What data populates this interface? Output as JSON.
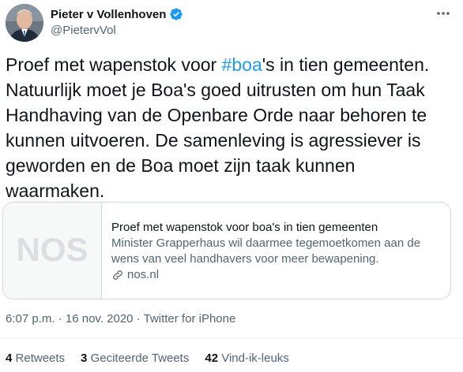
{
  "author": {
    "display_name": "Pieter v Vollenhoven",
    "handle": "@PietervVol",
    "verified_icon": "verified-badge-icon",
    "more_icon": "more-options-icon"
  },
  "tweet": {
    "text_before_hashtag": "Proef met wapenstok voor ",
    "hashtag": "#boa",
    "text_after_hashtag": "'s in tien gemeenten.\nNatuurlijk moet je Boa's goed uitrusten om hun Taak Handhaving van de Openbare Orde naar behoren te kunnen uitvoeren. De samenleving is agressiever is geworden en de Boa moet zijn taak kunnen waarmaken."
  },
  "card": {
    "logo_text": "NOS",
    "title": "Proef met wapenstok voor boa's in tien gemeenten",
    "description_line1": "Minister Grapperhaus wil daarmee tegemoetkomen aan de",
    "description_line2": "wens van veel handhavers voor meer bewapening.",
    "domain": "nos.nl",
    "link_icon": "link-icon"
  },
  "meta": {
    "time": "6:07 p.m.",
    "separator": " · ",
    "date": "16 nov. 2020",
    "source": "Twitter for iPhone"
  },
  "stats": {
    "retweets_count": "4",
    "retweets_label": "Retweets",
    "quotes_count": "3",
    "quotes_label": "Geciteerde Tweets",
    "likes_count": "42",
    "likes_label": "Vind-ik-leuks"
  },
  "colors": {
    "accent": "#1d9bf0",
    "secondary_text": "#536471",
    "border": "#cfd9de"
  }
}
